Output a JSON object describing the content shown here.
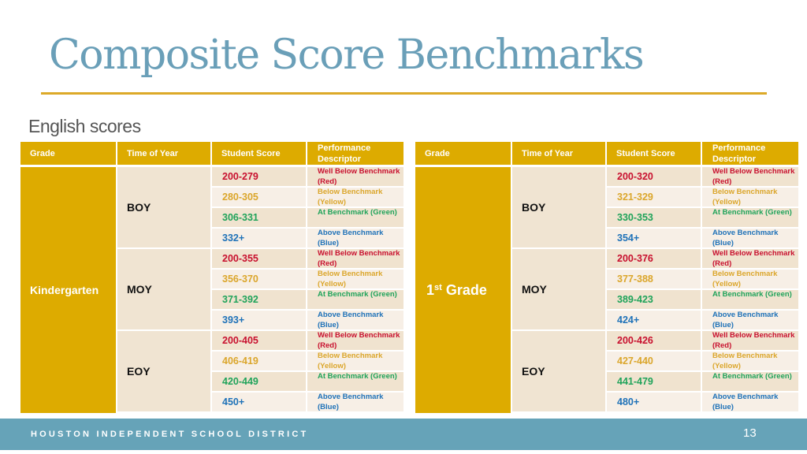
{
  "title": "Composite Score Benchmarks",
  "subtitle": "English scores",
  "colors": {
    "title": "#6a9fb8",
    "accent_gold": "#ddab00",
    "footer_bar": "#66a3b8",
    "red": "#c8102e",
    "yellow": "#dba62b",
    "green": "#1fa35a",
    "blue": "#1f72b8"
  },
  "headers": [
    "Grade",
    "Time of Year",
    "Student Score",
    "Performance Descriptor"
  ],
  "descriptors": [
    {
      "label": "Well Below Benchmark (Red)",
      "level": "red"
    },
    {
      "label": "Below Benchmark (Yellow)",
      "level": "yellow"
    },
    {
      "label": "At Benchmark (Green)",
      "level": "green"
    },
    {
      "label": "Above Benchmark (Blue)",
      "level": "blue"
    }
  ],
  "tables": [
    {
      "grade": "Kindergarten",
      "periods": [
        {
          "time": "BOY",
          "scores": [
            "200-279",
            "280-305",
            "306-331",
            "332+"
          ]
        },
        {
          "time": "MOY",
          "scores": [
            "200-355",
            "356-370",
            "371-392",
            "393+"
          ]
        },
        {
          "time": "EOY",
          "scores": [
            "200-405",
            "406-419",
            "420-449",
            "450+"
          ]
        }
      ]
    },
    {
      "grade": "1st Grade",
      "grade_number": "1",
      "grade_suffix": "st",
      "grade_word": "Grade",
      "periods": [
        {
          "time": "BOY",
          "scores": [
            "200-320",
            "321-329",
            "330-353",
            "354+"
          ]
        },
        {
          "time": "MOY",
          "scores": [
            "200-376",
            "377-388",
            "389-423",
            "424+"
          ]
        },
        {
          "time": "EOY",
          "scores": [
            "200-426",
            "427-440",
            "441-479",
            "480+"
          ]
        }
      ]
    }
  ],
  "footer": {
    "organization": "HOUSTON INDEPENDENT SCHOOL DISTRICT",
    "page_number": "13"
  }
}
